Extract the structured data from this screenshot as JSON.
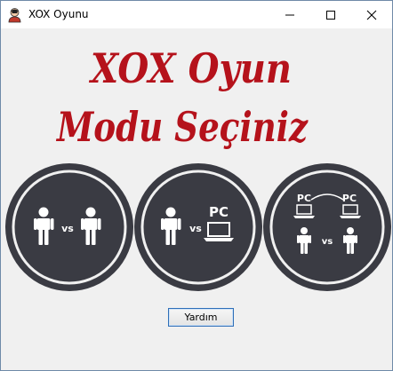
{
  "window": {
    "title": "XOX Oyunu",
    "controls": {
      "minimize": "minimize",
      "maximize": "maximize",
      "close": "close"
    }
  },
  "heading": {
    "line1": "XOX Oyun",
    "line2": "Modu Seçiniz",
    "color": "#b5121b"
  },
  "modes": [
    {
      "left": "",
      "vs": "vs",
      "right": ""
    },
    {
      "left": "",
      "vs": "vs",
      "right": "PC"
    },
    {
      "top_left": "PC",
      "top_right": "PC",
      "vs": "vs"
    }
  ],
  "help_button": {
    "label": "Yardım"
  },
  "colors": {
    "circle": "#3a3b43",
    "ring": "#f0f0f0",
    "icon": "#ffffff"
  }
}
